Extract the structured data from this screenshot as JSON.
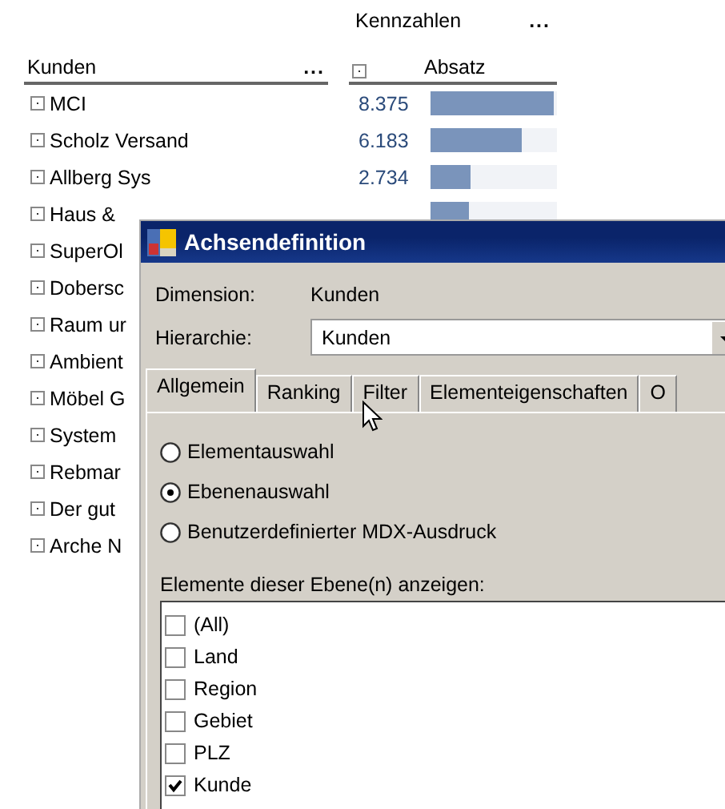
{
  "customers": {
    "header": "Kunden",
    "menu": "...",
    "rows": [
      {
        "name": "MCI"
      },
      {
        "name": "Scholz Versand"
      },
      {
        "name": "Allberg Sys"
      },
      {
        "name": "Haus &"
      },
      {
        "name": "SuperOl"
      },
      {
        "name": "Dobersc"
      },
      {
        "name": "Raum ur"
      },
      {
        "name": "Ambient"
      },
      {
        "name": "Möbel G"
      },
      {
        "name": "System"
      },
      {
        "name": "Rebmar"
      },
      {
        "name": "Der gut"
      },
      {
        "name": "Arche N"
      }
    ]
  },
  "measures": {
    "title": "Kennzahlen",
    "menu": "...",
    "column": "Absatz",
    "rows": [
      {
        "value": "8.375",
        "level": 0.98
      },
      {
        "value": "6.183",
        "level": 0.72
      },
      {
        "value": "2.734",
        "level": 0.32
      },
      {
        "level": 0.31
      }
    ]
  },
  "dialog": {
    "title": "Achsendefinition",
    "fields": [
      {
        "kind": "text",
        "label": "Dimension:",
        "value": "Kunden"
      },
      {
        "kind": "combo",
        "label": "Hierarchie:",
        "value": "Kunden"
      }
    ],
    "tabs": [
      {
        "label": "Allgemein",
        "selected": true
      },
      {
        "label": "Ranking",
        "selected": false
      },
      {
        "label": "Filter",
        "selected": false
      },
      {
        "label": "Elementeigenschaften",
        "selected": false
      },
      {
        "label": "O",
        "selected": false
      }
    ],
    "radios": [
      {
        "label": "Elementauswahl",
        "selected": false
      },
      {
        "label": "Ebenenauswahl",
        "selected": true
      },
      {
        "label": "Benutzerdefinierter MDX-Ausdruck",
        "selected": false
      }
    ],
    "list_label": "Elemente dieser Ebene(n) anzeigen:",
    "list": [
      {
        "label": "(All)",
        "checked": false
      },
      {
        "label": "Land",
        "checked": false
      },
      {
        "label": "Region",
        "checked": false
      },
      {
        "label": "Gebiet",
        "checked": false
      },
      {
        "label": "PLZ",
        "checked": false
      },
      {
        "label": "Kunde",
        "checked": true
      }
    ]
  }
}
